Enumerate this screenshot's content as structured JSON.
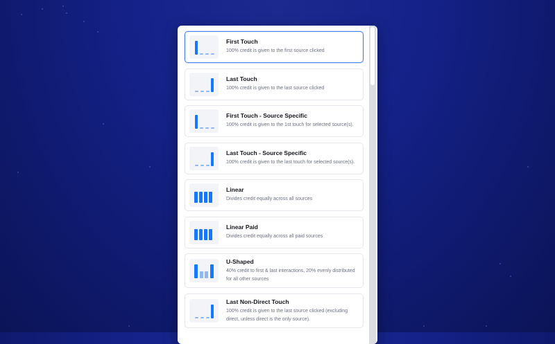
{
  "colors": {
    "accent": "#1677ff",
    "accent_light": "#8fb8f5",
    "selected_border": "#3b82f6"
  },
  "options": [
    {
      "title": "First Touch",
      "description": "100% credit is given to the first source clicked",
      "icon": "first-touch-chart-icon",
      "selected": true
    },
    {
      "title": "Last Touch",
      "description": "100% credit is given to the last source clicked",
      "icon": "last-touch-chart-icon"
    },
    {
      "title": "First Touch - Source Specific",
      "description": "100% credit is given to the 1st touch for selected source(s).",
      "icon": "first-touch-chart-icon"
    },
    {
      "title": "Last Touch - Source Specific",
      "description": "100% credit is given to the last touch for selected source(s).",
      "icon": "last-touch-chart-icon"
    },
    {
      "title": "Linear",
      "description": "Divides credit equally across all sources",
      "icon": "linear-chart-icon"
    },
    {
      "title": "Linear Paid",
      "description": "Divides credit equally across all paid sources",
      "icon": "linear-chart-icon"
    },
    {
      "title": "U-Shaped",
      "description": "40% credit to first & last interactions, 20% evenly distributed for all other sources",
      "icon": "u-shaped-chart-icon"
    },
    {
      "title": "Last Non-Direct Touch",
      "description": "100% credit is given to the last source clicked (excluding direct, unless direct is the only source).",
      "icon": "last-touch-chart-icon"
    }
  ]
}
